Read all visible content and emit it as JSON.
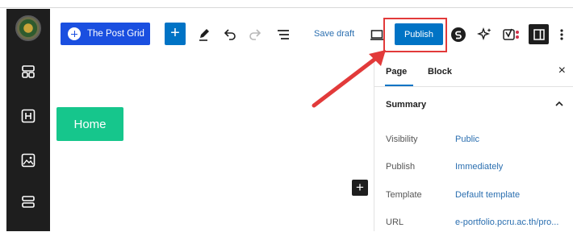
{
  "toolbar": {
    "post_grid_label": "The Post Grid",
    "add_label": "+",
    "save_draft_label": "Save draft",
    "publish_label": "Publish"
  },
  "canvas": {
    "home_button_label": "Home",
    "inserter_label": "+"
  },
  "panel": {
    "tabs": [
      {
        "label": "Page"
      },
      {
        "label": "Block"
      }
    ],
    "close_label": "×",
    "section_title": "Summary",
    "rows": [
      {
        "label": "Visibility",
        "value": "Public"
      },
      {
        "label": "Publish",
        "value": "Immediately"
      },
      {
        "label": "Template",
        "value": "Default template"
      },
      {
        "label": "URL",
        "value": "e-portfolio.pcru.ac.th/pro..."
      }
    ]
  },
  "icons": {
    "left": [
      "site-logo",
      "patterns-icon",
      "heading-block-icon",
      "image-block-icon",
      "template-parts-icon"
    ],
    "toolbar": [
      "post-grid-icon",
      "plus-icon",
      "pencil-icon",
      "undo-icon",
      "redo-icon",
      "list-view-icon",
      "preview-device-icon",
      "jetpack-s-icon",
      "ai-sparkle-icon",
      "yoast-icon",
      "settings-panel-icon",
      "more-options-icon"
    ]
  },
  "colors": {
    "accent": "#0073c5",
    "post_grid_blue": "#1a4fe0",
    "home_button": "#16c68c",
    "annotation_red": "#e23a3a",
    "left_bar": "#1e1e1e"
  }
}
